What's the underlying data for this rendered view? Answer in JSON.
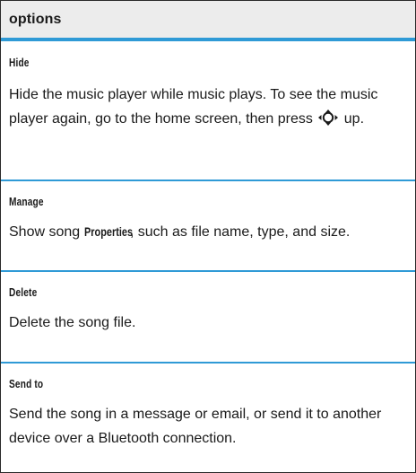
{
  "table": {
    "header": "options",
    "rows": [
      {
        "name": "Hide",
        "description_before_icon": "Hide the music player while music plays. To see the music player again, go to the home screen, then press",
        "icon": "nav-key-up-icon",
        "description_after_icon": "up."
      },
      {
        "name": "Manage",
        "description_prefix": "Show song",
        "description_emphasis": "Properties",
        "description_suffix": ", such as file name, type, and size."
      },
      {
        "name": "Delete",
        "description": "Delete the song file."
      },
      {
        "name": "Send to",
        "description": "Send the song in a message or email, or send it to another device over a Bluetooth connection."
      }
    ]
  },
  "colors": {
    "rule": "#2f9ad6",
    "header_bg": "#ececec",
    "text": "#1a1a1a"
  }
}
